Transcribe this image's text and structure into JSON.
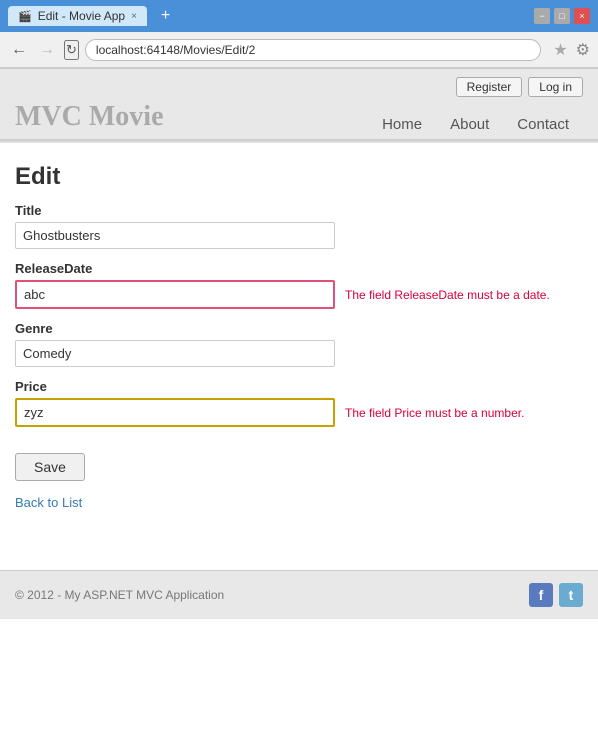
{
  "browser": {
    "tab_title": "Edit - Movie App",
    "url": "localhost:64148/Movies/Edit/2",
    "new_tab_label": "+",
    "close_btn": "×",
    "minimize_btn": "−",
    "maximize_btn": "□",
    "star_icon": "★",
    "settings_icon": "⚙"
  },
  "header": {
    "app_title": "MVC Movie",
    "register_label": "Register",
    "login_label": "Log in",
    "nav_links": [
      {
        "label": "Home",
        "id": "home"
      },
      {
        "label": "About",
        "id": "about"
      },
      {
        "label": "Contact",
        "id": "contact"
      }
    ]
  },
  "form": {
    "page_title": "Edit",
    "title_label": "Title",
    "title_value": "Ghostbusters",
    "release_label": "ReleaseDate",
    "release_value": "abc",
    "release_error": "The field ReleaseDate must be a date.",
    "genre_label": "Genre",
    "genre_value": "Comedy",
    "price_label": "Price",
    "price_value": "zyz",
    "price_error": "The field Price must be a number.",
    "save_label": "Save",
    "back_label": "Back to List"
  },
  "footer": {
    "text": "© 2012 - My ASP.NET MVC Application",
    "fb_icon": "f",
    "tw_icon": "t"
  }
}
